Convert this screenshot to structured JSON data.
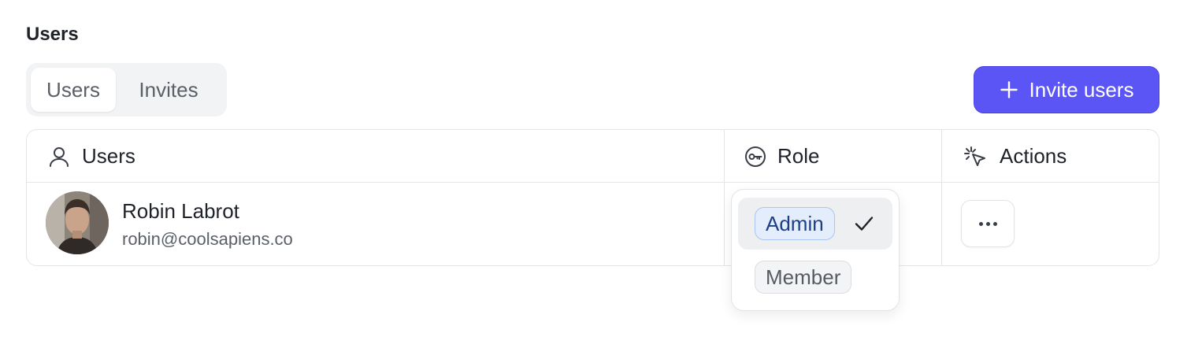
{
  "section_title": "Users",
  "tabs": [
    {
      "label": "Users",
      "active": true
    },
    {
      "label": "Invites",
      "active": false
    }
  ],
  "invite_button": {
    "label": "Invite users",
    "icon": "plus-icon",
    "color": "#5b55f6"
  },
  "table": {
    "columns": [
      {
        "label": "Users",
        "icon": "user-icon"
      },
      {
        "label": "Role",
        "icon": "key-icon"
      },
      {
        "label": "Actions",
        "icon": "cursor-click-icon"
      }
    ],
    "rows": [
      {
        "name": "Robin Labrot",
        "email": "robin@coolsapiens.co",
        "role": "Admin",
        "actions_icon": "more-horizontal-icon"
      }
    ]
  },
  "role_dropdown": {
    "options": [
      {
        "label": "Admin",
        "selected": true,
        "color": "#1d3f86"
      },
      {
        "label": "Member",
        "selected": false,
        "color": "#565b63"
      }
    ],
    "selected_icon": "check-icon"
  }
}
